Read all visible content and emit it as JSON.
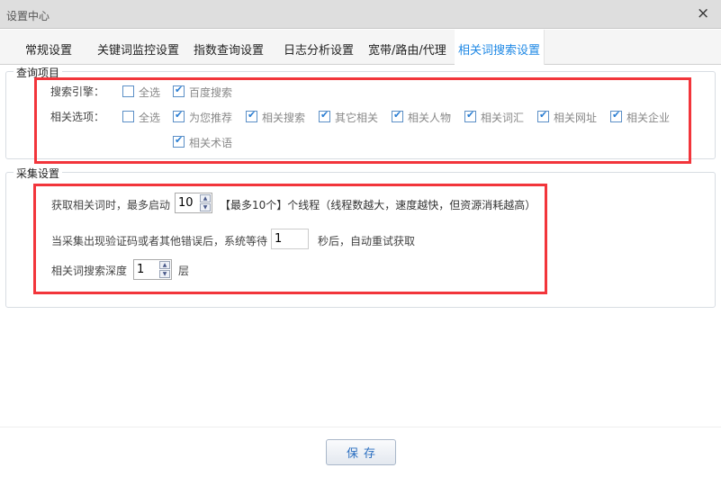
{
  "window": {
    "title": "设置中心",
    "close_icon": "×"
  },
  "tabs": [
    {
      "label": "常规设置"
    },
    {
      "label": "关键词监控设置"
    },
    {
      "label": "指数查询设置"
    },
    {
      "label": "日志分析设置"
    },
    {
      "label": "宽带/路由/代理"
    },
    {
      "label": "相关词搜索设置",
      "active": true
    }
  ],
  "query_section": {
    "legend": "查询项目",
    "engine_label": "搜索引擎：",
    "engines": [
      {
        "label": "全选",
        "checked": false
      },
      {
        "label": "百度搜索",
        "checked": true
      }
    ],
    "options_label": "相关选项：",
    "options": [
      {
        "label": "全选",
        "checked": false
      },
      {
        "label": "为您推荐",
        "checked": true
      },
      {
        "label": "相关搜索",
        "checked": true
      },
      {
        "label": "其它相关",
        "checked": true
      },
      {
        "label": "相关人物",
        "checked": true
      },
      {
        "label": "相关词汇",
        "checked": true
      },
      {
        "label": "相关网址",
        "checked": true
      },
      {
        "label": "相关企业",
        "checked": true
      },
      {
        "label": "相关术语",
        "checked": true
      }
    ]
  },
  "collect_section": {
    "legend": "采集设置",
    "threads_prefix": "获取相关词时，最多启动",
    "threads_value": "10",
    "threads_suffix": "【最多10个】个线程（线程数越大，速度越快，但资源消耗越高）",
    "wait_prefix": "当采集出现验证码或者其他错误后，系统等待",
    "wait_value": "1",
    "wait_suffix": "秒后，自动重试获取",
    "depth_prefix": "相关词搜索深度",
    "depth_value": "1",
    "depth_suffix": "层"
  },
  "footer": {
    "save_label": "保存"
  },
  "colors": {
    "accent": "#1e88e5",
    "highlight": "#f2353b"
  }
}
